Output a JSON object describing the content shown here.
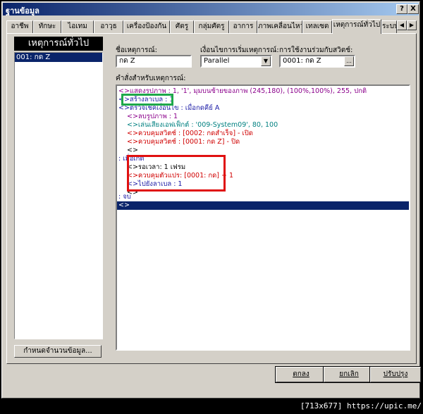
{
  "window": {
    "title": "ฐานข้อมูล"
  },
  "titlebar_buttons": {
    "help": "?",
    "close": "X"
  },
  "tabs": [
    "อาชีพ",
    "ทักษะ",
    "ไอเทม",
    "อาวุธ",
    "เครื่องป้องกัน",
    "ศัตรู",
    "กลุ่มศัตรู",
    "อาการ",
    "ภาพเคลื่อนไหว",
    "เทลเซต",
    "เหตุการณ์ทั่วไป",
    "ระบบ"
  ],
  "tab_scroll": {
    "left": "◀",
    "right": "▶"
  },
  "left_panel": {
    "header": "เหตุการณ์ทั่วไป",
    "items": [
      "001: กด Z"
    ],
    "button": "กำหนดจำนวนข้อมูล..."
  },
  "form": {
    "name_label": "ชื่อเหตุการณ์:",
    "name_value": "กด Z",
    "start_label": "เงื่อนไขการเริ่มเหตุการณ์:",
    "start_value": "Parallel",
    "switch_label": "การใช้งานร่วมกับสวิตช์:",
    "switch_value": "0001: กด Z",
    "ellipsis": "...",
    "commands_label": "คำสั่งสำหรับเหตุการณ์:"
  },
  "commands": [
    {
      "text": "<>แสดงรูปภาพ : 1, '1', มุมบนซ้ายของภาพ (245,180), (100%,100%), 255, ปกติ",
      "color": "purple"
    },
    {
      "text": "<>สร้างลาเบล : 1",
      "color": "blue"
    },
    {
      "text": "<>ตรวจเช็คเงื่อนไข : เมื่อกดคีย์ A",
      "color": "blue"
    },
    {
      "text": "<>ลบรูปภาพ : 1",
      "color": "purple"
    },
    {
      "text": "<>เล่นเสียงเอฟเฟ็กต์ : '009-System09', 80, 100",
      "color": "teal"
    },
    {
      "text": "<>ควบคุมสวิตช์ : [0002: กดสำเร็จ] - เปิด",
      "color": "red"
    },
    {
      "text": "<>ควบคุมสวิตช์ : [0001: กด Z] - ปิด",
      "color": "red"
    },
    {
      "text": "<>",
      "color": "black"
    },
    {
      "text": ": เมื่อเกิด",
      "color": "blue"
    },
    {
      "text": "<>รอเวลา: 1 เฟรม",
      "color": "black"
    },
    {
      "text": "<>ควบคุมตัวแปร: [0001: กด] + 1",
      "color": "red"
    },
    {
      "text": "<>ไปยังลาเบล : 1",
      "color": "blue"
    },
    {
      "text": "<>",
      "color": "black"
    },
    {
      "text": ": จบ",
      "color": "blue"
    },
    {
      "text": "<>",
      "color": "white"
    }
  ],
  "buttons": {
    "ok": "ตกลง",
    "cancel": "ยกเลิก",
    "apply": "ปรับปรุง"
  },
  "footer": "[713x677] https://upic.me/"
}
